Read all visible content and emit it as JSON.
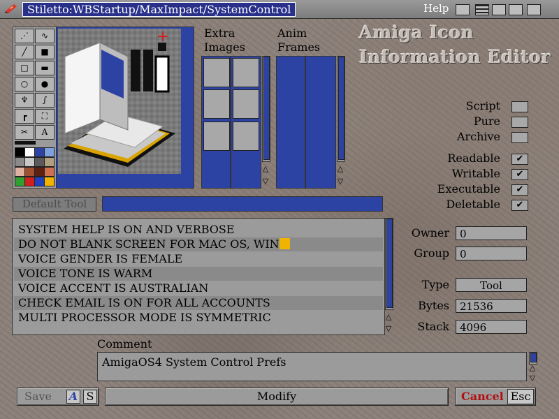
{
  "window": {
    "title": "Stiletto:WBStartup/MaxImpact/SystemControl",
    "help_label": "Help"
  },
  "extra_images": {
    "label_line1": "Extra",
    "label_line2": "Images"
  },
  "anim_frames": {
    "label_line1": "Anim",
    "label_line2": "Frames"
  },
  "heading": {
    "line1": "Amiga Icon",
    "line2": "Information Editor"
  },
  "flags": [
    {
      "label": "Script",
      "checked": false
    },
    {
      "label": "Pure",
      "checked": false
    },
    {
      "label": "Archive",
      "checked": false
    },
    {
      "label": "Readable",
      "checked": true
    },
    {
      "label": "Writable",
      "checked": true
    },
    {
      "label": "Executable",
      "checked": true
    },
    {
      "label": "Deletable",
      "checked": true
    }
  ],
  "check_glyph": "✔",
  "default_tool": {
    "button_label": "Default Tool",
    "value": ""
  },
  "tool_types": [
    "SYSTEM HELP IS ON AND VERBOSE",
    "DO NOT BLANK SCREEN FOR MAC OS, WIN",
    "VOICE GENDER IS FEMALE",
    "VOICE TONE IS WARM",
    "VOICE ACCENT IS AUSTRALIAN",
    "CHECK EMAIL IS ON FOR ALL ACCOUNTS",
    "MULTI PROCESSOR MODE IS SYMMETRIC"
  ],
  "fields": {
    "owner": {
      "label": "Owner",
      "value": "0"
    },
    "group": {
      "label": "Group",
      "value": "0"
    },
    "type": {
      "label": "Type",
      "value": "Tool"
    },
    "bytes": {
      "label": "Bytes",
      "value": "21536"
    },
    "stack": {
      "label": "Stack",
      "value": "4096"
    }
  },
  "comment": {
    "label": "Comment",
    "value": "AmigaOS4 System Control Prefs"
  },
  "buttons": {
    "save": "Save",
    "save_key_a": "A",
    "save_key_s": "S",
    "modify": "Modify",
    "cancel": "Cancel",
    "cancel_key": "Esc"
  },
  "colors": {
    "accent_blue": "#2d43a3",
    "cursor_yellow": "#f0b400",
    "cancel_red": "#b01010"
  }
}
